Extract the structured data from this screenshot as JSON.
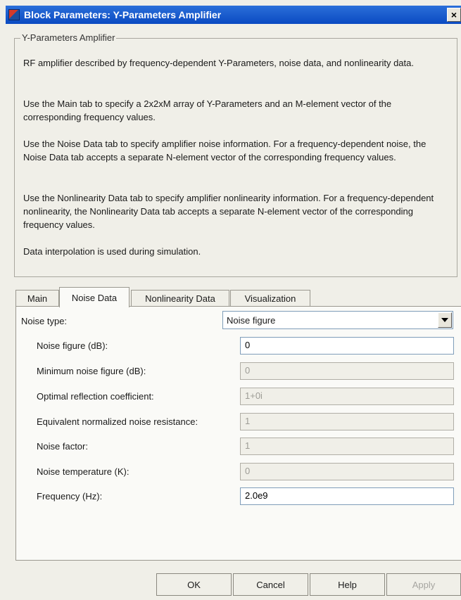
{
  "window": {
    "title": "Block Parameters: Y-Parameters Amplifier",
    "close_label": "×"
  },
  "group": {
    "legend": "Y-Parameters Amplifier",
    "paragraphs": [
      "RF amplifier described by frequency-dependent Y-Parameters, noise data, and nonlinearity data.",
      "Use the Main tab to specify a 2x2xM array of Y-Parameters and an M-element vector of the corresponding frequency values.",
      "Use the Noise Data tab to specify amplifier noise information. For a frequency-dependent noise, the Noise Data tab accepts a separate N-element vector of the corresponding frequency values.",
      "Use the Nonlinearity Data tab to specify amplifier nonlinearity information. For a frequency-dependent nonlinearity, the Nonlinearity Data tab accepts a separate N-element vector of the corresponding frequency values.",
      "Data interpolation is used during simulation."
    ]
  },
  "tabs": [
    "Main",
    "Noise Data",
    "Nonlinearity Data",
    "Visualization"
  ],
  "active_tab": "Noise Data",
  "noise": {
    "type_label": "Noise type:",
    "type_value": "Noise figure",
    "fields": [
      {
        "label": "Noise figure (dB):",
        "value": "0",
        "enabled": true
      },
      {
        "label": "Minimum noise figure (dB):",
        "value": "0",
        "enabled": false
      },
      {
        "label": "Optimal reflection coefficient:",
        "value": "1+0i",
        "enabled": false
      },
      {
        "label": "Equivalent normalized noise resistance:",
        "value": "1",
        "enabled": false
      },
      {
        "label": "Noise factor:",
        "value": "1",
        "enabled": false
      },
      {
        "label": "Noise temperature (K):",
        "value": "0",
        "enabled": false
      },
      {
        "label": "Frequency (Hz):",
        "value": "2.0e9",
        "enabled": true
      }
    ]
  },
  "buttons": {
    "ok": "OK",
    "cancel": "Cancel",
    "help": "Help",
    "apply": "Apply"
  }
}
